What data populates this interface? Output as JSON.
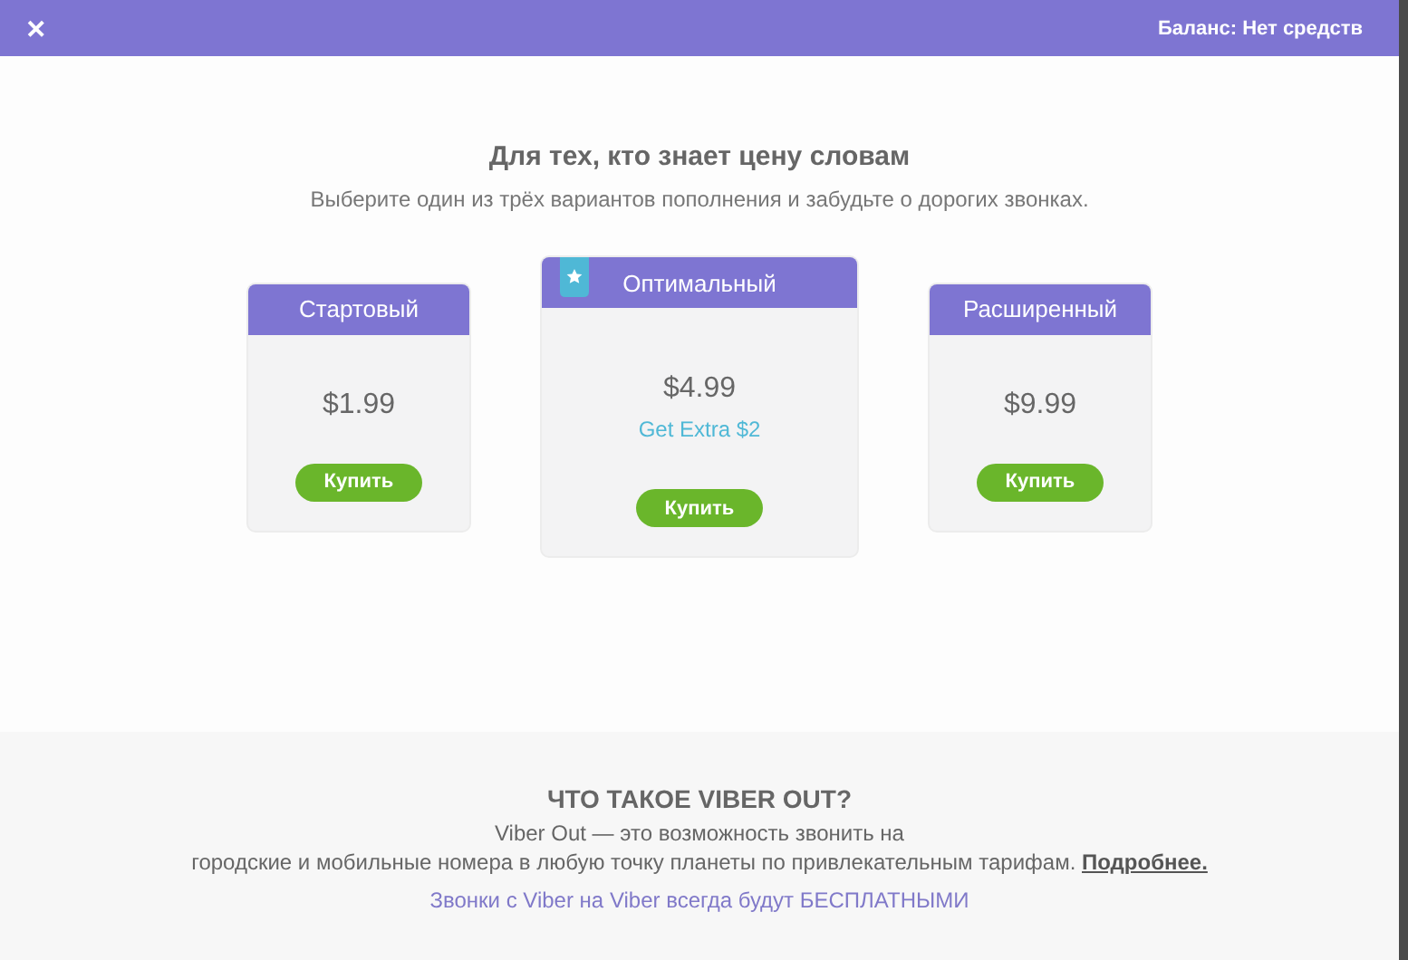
{
  "header": {
    "close": "✕",
    "balance": "Баланс: Нет средств"
  },
  "intro": {
    "title": "Для тех, кто знает цену словам",
    "subtitle": "Выберите один из трёх вариантов пополнения и забудьте о дорогих звонках."
  },
  "plans": [
    {
      "name": "Стартовый",
      "price": "$1.99",
      "featured": false,
      "buy": "Купить"
    },
    {
      "name": "Оптимальный",
      "price": "$4.99",
      "bonus": "Get Extra $2",
      "featured": true,
      "buy": "Купить"
    },
    {
      "name": "Расширенный",
      "price": "$9.99",
      "featured": false,
      "buy": "Купить"
    }
  ],
  "about": {
    "title": "ЧТО ТАКОЕ VIBER OUT?",
    "line_1": "Viber Out — это возможность звонить на",
    "line_2": "городские и мобильные номера в любую точку планеты по привлекательным тарифам.",
    "link": "Подробнее.",
    "note": "Звонки с Viber на Viber всегда будут БЕСПЛАТНЫМИ"
  }
}
